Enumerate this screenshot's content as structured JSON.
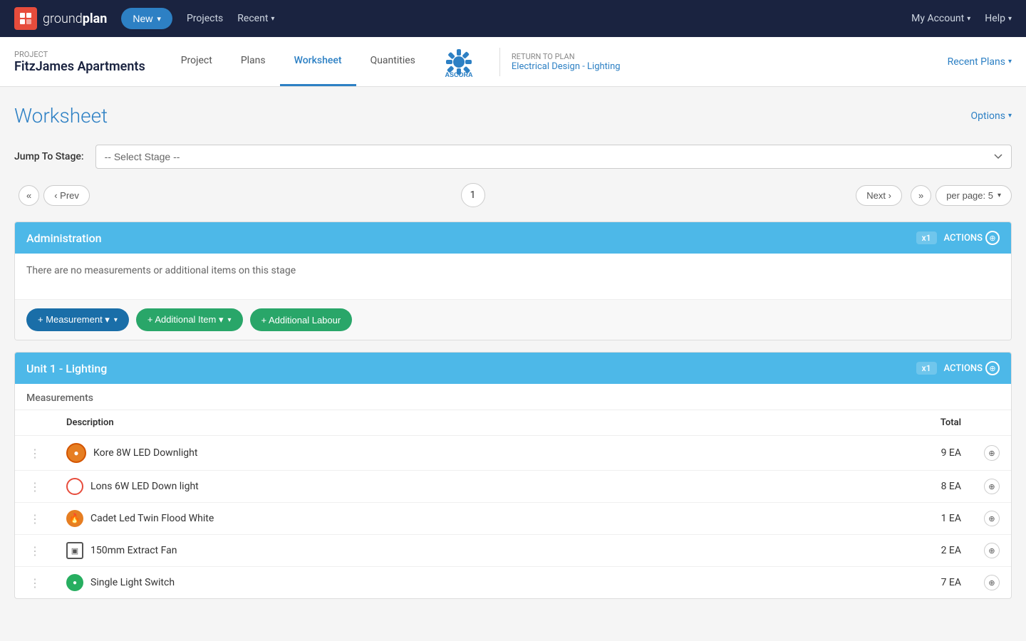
{
  "topNav": {
    "logoText1": "ground",
    "logoText2": "plan",
    "newButton": "New",
    "projectsLink": "Projects",
    "recentLink": "Recent",
    "accountLink": "My Account",
    "helpLink": "Help"
  },
  "subNav": {
    "projectLabel": "PROJECT",
    "projectName": "FitzJames Apartments",
    "tabs": [
      {
        "id": "project",
        "label": "Project",
        "active": false
      },
      {
        "id": "plans",
        "label": "Plans",
        "active": false
      },
      {
        "id": "worksheet",
        "label": "Worksheet",
        "active": true
      },
      {
        "id": "quantities",
        "label": "Quantities",
        "active": false
      }
    ],
    "returnToPlanLabel": "RETURN TO PLAN",
    "returnToPlanLink": "Electrical Design - Lighting",
    "recentPlansBtn": "Recent Plans"
  },
  "page": {
    "title": "Worksheet",
    "optionsBtn": "Options",
    "jumpToStageLabel": "Jump To Stage:",
    "jumpToStagePlaceholder": "-- Select Stage --",
    "paginationCurrent": "1",
    "nextBtn": "Next",
    "perPageBtn": "per page: 5"
  },
  "stages": [
    {
      "id": "administration",
      "title": "Administration",
      "x1Label": "x1",
      "actionsLabel": "ACTIONS",
      "emptyMessage": "There are no measurements or additional items on this stage",
      "addMeasurementBtn": "+ Measurement",
      "addItemBtn": "+ Additional Item",
      "addLabourBtn": "+ Additional Labour"
    },
    {
      "id": "unit1-lighting",
      "title": "Unit 1 - Lighting",
      "x1Label": "x1",
      "actionsLabel": "ACTIONS",
      "measurementsLabel": "Measurements",
      "columns": [
        "Description",
        "Total"
      ],
      "items": [
        {
          "id": 1,
          "icon": "circle-filled-orange",
          "description": "Kore 8W LED Downlight",
          "total": "9 EA"
        },
        {
          "id": 2,
          "icon": "circle-ring-red",
          "description": "Lons 6W LED Down light",
          "total": "8 EA"
        },
        {
          "id": 3,
          "icon": "flame-orange",
          "description": "Cadet Led Twin Flood White",
          "total": "1 EA"
        },
        {
          "id": 4,
          "icon": "square-outline",
          "description": "150mm Extract Fan",
          "total": "2 EA"
        },
        {
          "id": 5,
          "icon": "circle-green-small",
          "description": "Single Light Switch",
          "total": "7 EA"
        }
      ]
    }
  ]
}
